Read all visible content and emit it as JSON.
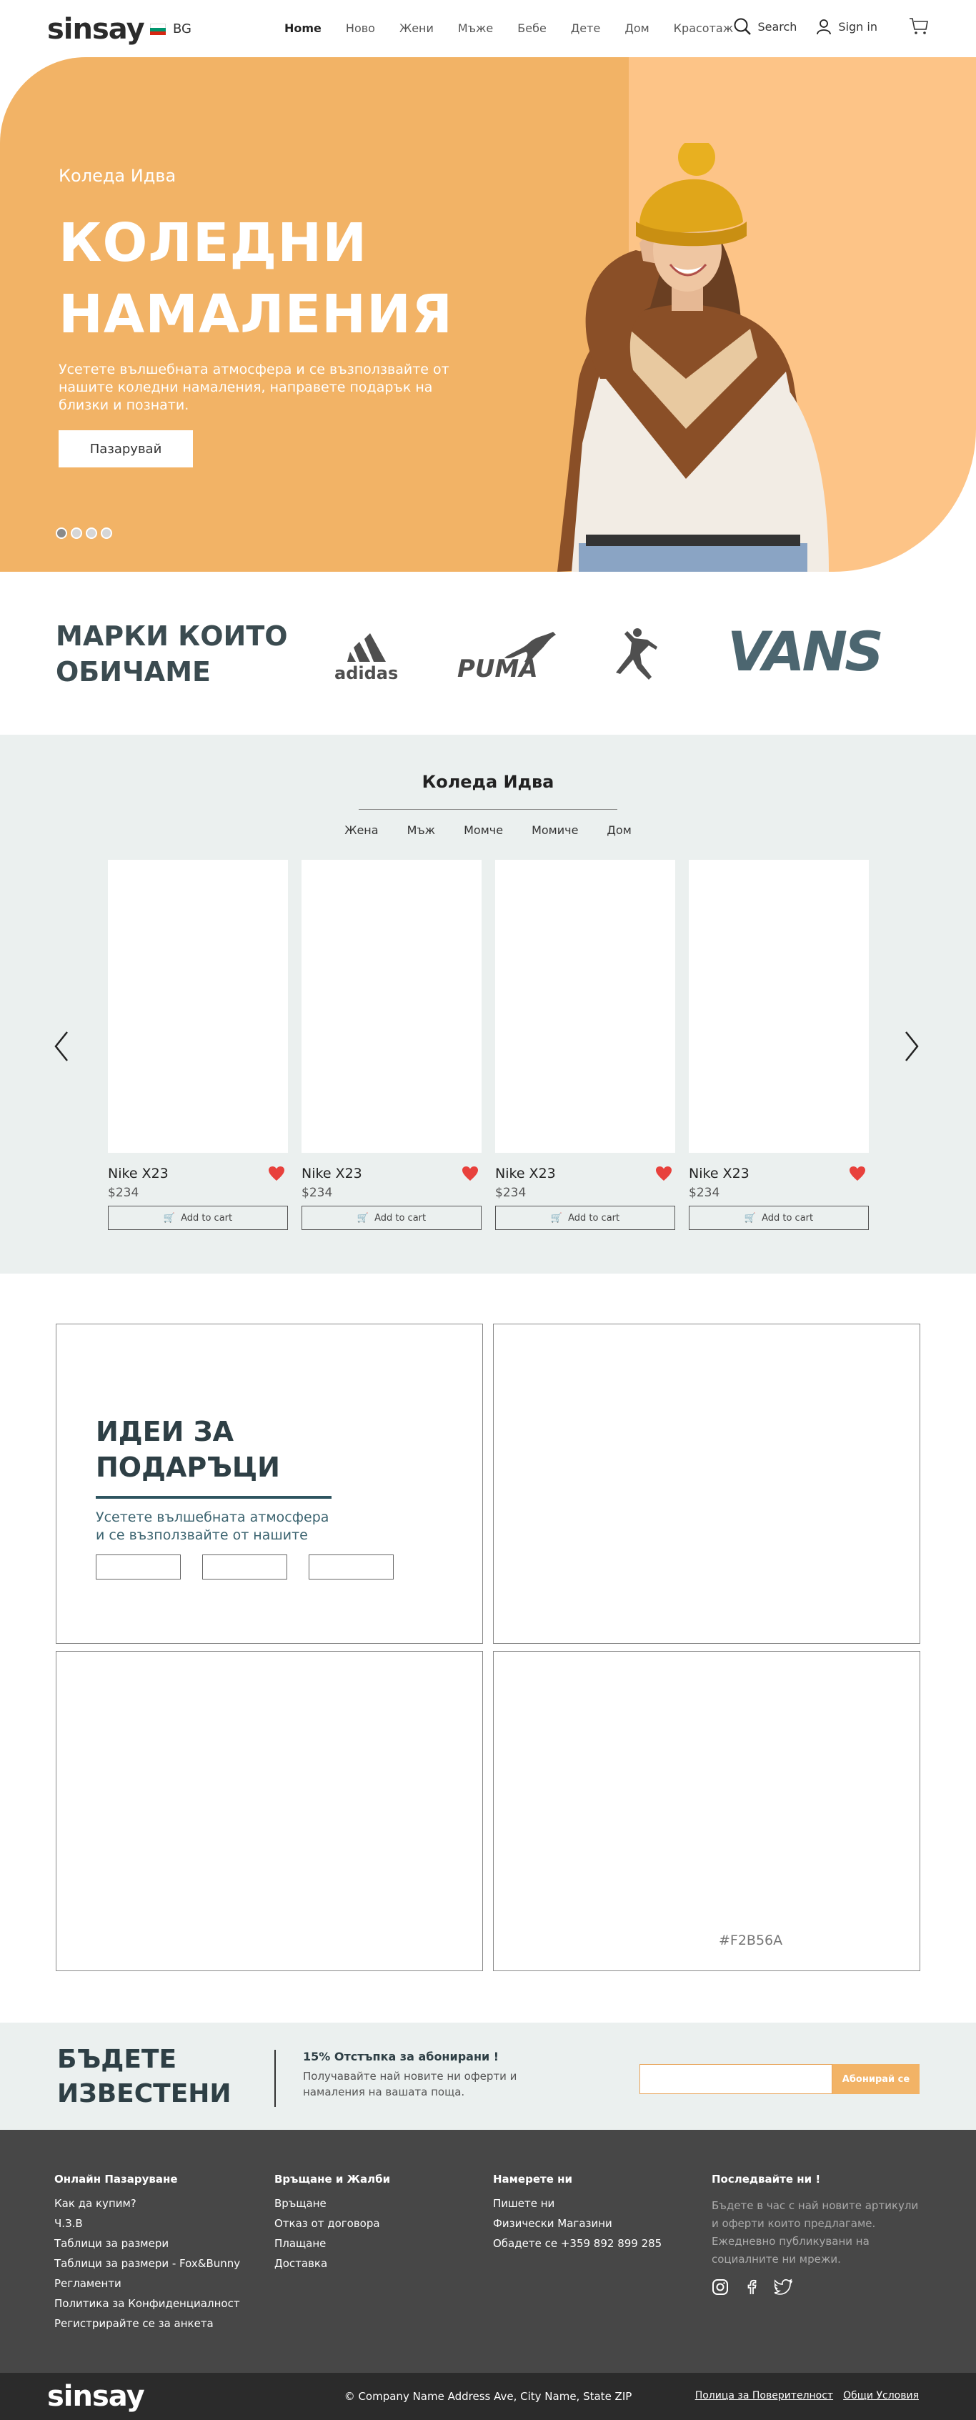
{
  "header": {
    "logo": "sinsay",
    "lang": "BG",
    "nav": [
      "Home",
      "Ново",
      "Жени",
      "Мъже",
      "Бебе",
      "Дете",
      "Дом",
      "Красотаж"
    ],
    "search_label": "Search",
    "signin_label": "Sign in"
  },
  "hero": {
    "subtitle": "Коледа Идва",
    "title_line1": "КОЛЕДНИ",
    "title_line2": "НАМАЛЕНИЯ",
    "text": "Усетете вълшебната атмосфера и се възползвайте от нашите коледни намаления, направете подарък на близки и познати.",
    "button": "Пазарувай",
    "color_left": "#F2B366",
    "color_right": "#FDC487"
  },
  "brands": {
    "title_line1": "МАРКИ КОИТО",
    "title_line2": "ОБИЧАМЕ",
    "items": [
      "adidas",
      "PUMA",
      "jordan",
      "VANS"
    ]
  },
  "christmas": {
    "title": "Коледа Идва",
    "tabs": [
      "Жена",
      "Мъж",
      "Момче",
      "Момиче",
      "Дом"
    ],
    "products": [
      {
        "name": "Nike X23",
        "price": "$234",
        "cart": "Add to cart"
      },
      {
        "name": "Nike X23",
        "price": "$234",
        "cart": "Add to cart"
      },
      {
        "name": "Nike X23",
        "price": "$234",
        "cart": "Add to cart"
      },
      {
        "name": "Nike X23",
        "price": "$234",
        "cart": "Add to cart"
      }
    ]
  },
  "gifts": {
    "title_line1": "ИДЕИ ЗА",
    "title_line2": "ПОДАРЪЦИ",
    "text": "Усетете вълшебната атмосфера и се възползвайте от нашите",
    "color_note": "#F2B56A"
  },
  "newsletter": {
    "title_line1": "БЪДЕТЕ",
    "title_line2": "ИЗВЕСТЕНИ",
    "heading": "15% Отстъпка за абонирани !",
    "text": "Получавайте най новите ни оферти и намаления на вашата поща.",
    "button": "Абонирай се"
  },
  "footer": {
    "col1_title": "Онлайн Пазаруване",
    "col1_items": [
      "Как да купим?",
      "Ч.З.В",
      "Таблици за размери",
      "Таблици за размери - Fox&Bunny",
      "Регламенти",
      "Политика за Конфиденциалност",
      "Регистрирайте се за анкета"
    ],
    "col2_title": "Връщане и Жалби",
    "col2_items": [
      "Връщане",
      "Отказ от договора",
      "Плащане",
      "Доставка"
    ],
    "col3_title": "Намерете ни",
    "col3_items": [
      "Пишете ни",
      "Физически Магазини",
      "Обадете се +359 892 899 285"
    ],
    "col4_title": "Последвайте ни !",
    "col4_text": "Бъдете в час с най новите артикули и оферти които предлагаме. Ежедневно публикувани на социалните ни мрежи.",
    "bottom_logo": "sinsay",
    "address": "© Company Name Address Ave, City Name, State ZIP",
    "privacy": "Полица за Поверителност",
    "terms": "Общи Условия"
  }
}
